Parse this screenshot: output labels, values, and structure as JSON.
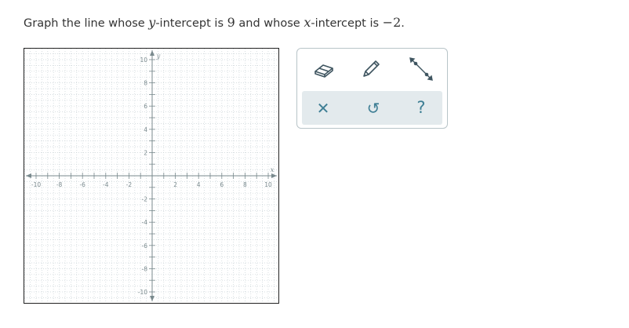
{
  "prompt": {
    "part1": "Graph the line whose ",
    "y_var": "y",
    "part2": "-intercept is ",
    "y_intercept": "9",
    "part3": " and whose ",
    "x_var": "x",
    "part4": "-intercept is ",
    "x_intercept": "−2",
    "part5": "."
  },
  "graph": {
    "x_axis_label": "x",
    "y_axis_label": "y",
    "x_tick_labels": [
      "-10",
      "-8",
      "-6",
      "-4",
      "-2",
      "2",
      "4",
      "6",
      "8",
      "10"
    ],
    "y_tick_labels": [
      "10",
      "8",
      "6",
      "4",
      "2",
      "-2",
      "-4",
      "-6",
      "-8",
      "-10"
    ],
    "x_range": [
      -11,
      11
    ],
    "y_range": [
      -11,
      11
    ],
    "grid": true,
    "grid_color": "#c8d2d6",
    "axis_color": "#7a8a8e"
  },
  "toolbox": {
    "tools": [
      "eraser-icon",
      "pencil-icon",
      "line-segment-icon"
    ],
    "actions": {
      "clear_glyph": "✕",
      "undo_glyph": "↺",
      "help_glyph": "?"
    },
    "icon_color": "#3f7f95",
    "action_row_bg": "#e3eaed"
  }
}
